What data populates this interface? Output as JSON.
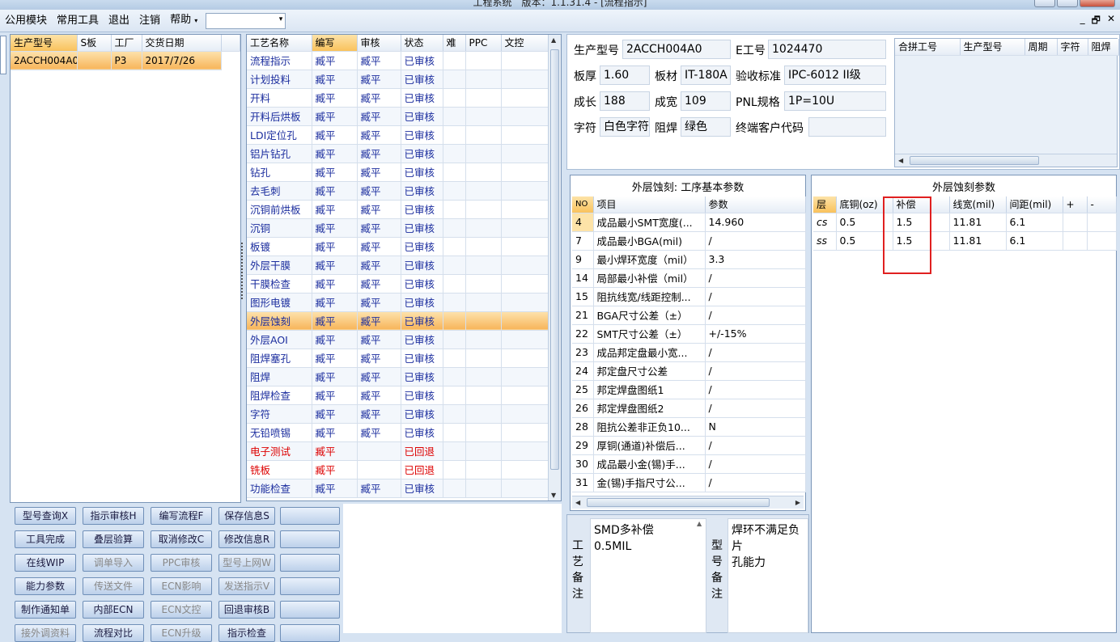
{
  "window": {
    "title": "工程系统　版本：1.1.31.4 - [流程指示]"
  },
  "menu": {
    "items": [
      "公用模块",
      "常用工具",
      "退出",
      "注销",
      "帮助"
    ],
    "help_arrow": "▾"
  },
  "mdi": {
    "minimize": "_",
    "restore": "🗗",
    "close": "✕"
  },
  "orders": {
    "columns": [
      "生产型号",
      "S板",
      "工厂",
      "交货日期"
    ],
    "rows": [
      [
        "2ACCH004A0",
        "",
        "P3",
        "2017/7/26"
      ]
    ]
  },
  "process": {
    "columns": [
      "工艺名称",
      "编写",
      "审核",
      "状态",
      "难",
      "PPC",
      "文控"
    ],
    "rows": [
      {
        "name": "流程指示",
        "writer": "臧平",
        "reviewer": "臧平",
        "status": "已审核",
        "red": false
      },
      {
        "name": "计划投料",
        "writer": "臧平",
        "reviewer": "臧平",
        "status": "已审核",
        "red": false
      },
      {
        "name": "开料",
        "writer": "臧平",
        "reviewer": "臧平",
        "status": "已审核",
        "red": false
      },
      {
        "name": "开料后烘板",
        "writer": "臧平",
        "reviewer": "臧平",
        "status": "已审核",
        "red": false
      },
      {
        "name": "LDI定位孔",
        "writer": "臧平",
        "reviewer": "臧平",
        "status": "已审核",
        "red": false
      },
      {
        "name": "铝片钻孔",
        "writer": "臧平",
        "reviewer": "臧平",
        "status": "已审核",
        "red": false
      },
      {
        "name": "钻孔",
        "writer": "臧平",
        "reviewer": "臧平",
        "status": "已审核",
        "red": false
      },
      {
        "name": "去毛刺",
        "writer": "臧平",
        "reviewer": "臧平",
        "status": "已审核",
        "red": false
      },
      {
        "name": "沉铜前烘板",
        "writer": "臧平",
        "reviewer": "臧平",
        "status": "已审核",
        "red": false
      },
      {
        "name": "沉铜",
        "writer": "臧平",
        "reviewer": "臧平",
        "status": "已审核",
        "red": false
      },
      {
        "name": "板镀",
        "writer": "臧平",
        "reviewer": "臧平",
        "status": "已审核",
        "red": false
      },
      {
        "name": "外层干膜",
        "writer": "臧平",
        "reviewer": "臧平",
        "status": "已审核",
        "red": false
      },
      {
        "name": "干膜检查",
        "writer": "臧平",
        "reviewer": "臧平",
        "status": "已审核",
        "red": false
      },
      {
        "name": "图形电镀",
        "writer": "臧平",
        "reviewer": "臧平",
        "status": "已审核",
        "red": false
      },
      {
        "name": "外层蚀刻",
        "writer": "臧平",
        "reviewer": "臧平",
        "status": "已审核",
        "red": false,
        "selected": true
      },
      {
        "name": "外层AOI",
        "writer": "臧平",
        "reviewer": "臧平",
        "status": "已审核",
        "red": false
      },
      {
        "name": "阻焊塞孔",
        "writer": "臧平",
        "reviewer": "臧平",
        "status": "已审核",
        "red": false
      },
      {
        "name": "阻焊",
        "writer": "臧平",
        "reviewer": "臧平",
        "status": "已审核",
        "red": false
      },
      {
        "name": "阻焊检查",
        "writer": "臧平",
        "reviewer": "臧平",
        "status": "已审核",
        "red": false
      },
      {
        "name": "字符",
        "writer": "臧平",
        "reviewer": "臧平",
        "status": "已审核",
        "red": false
      },
      {
        "name": "无铅喷锡",
        "writer": "臧平",
        "reviewer": "臧平",
        "status": "已审核",
        "red": false
      },
      {
        "name": "电子测试",
        "writer": "臧平",
        "reviewer": "",
        "status": "已回退",
        "red": true
      },
      {
        "name": "铣板",
        "writer": "臧平",
        "reviewer": "",
        "status": "已回退",
        "red": true
      },
      {
        "name": "功能检查",
        "writer": "臧平",
        "reviewer": "臧平",
        "status": "已审核",
        "red": false
      }
    ]
  },
  "buttons": [
    {
      "label": "型号查询X",
      "disabled": false
    },
    {
      "label": "指示审核H",
      "disabled": false
    },
    {
      "label": "编写流程F",
      "disabled": false
    },
    {
      "label": "保存信息S",
      "disabled": false
    },
    {
      "label": "",
      "disabled": false
    },
    {
      "label": "工具完成",
      "disabled": false
    },
    {
      "label": "叠层验算",
      "disabled": false
    },
    {
      "label": "取消修改C",
      "disabled": false
    },
    {
      "label": "修改信息R",
      "disabled": false
    },
    {
      "label": "",
      "disabled": false
    },
    {
      "label": "在线WIP",
      "disabled": false
    },
    {
      "label": "调单导入",
      "disabled": true
    },
    {
      "label": "PPC审核",
      "disabled": true
    },
    {
      "label": "型号上网W",
      "disabled": true
    },
    {
      "label": "",
      "disabled": false
    },
    {
      "label": "能力参数",
      "disabled": false
    },
    {
      "label": "传送文件",
      "disabled": true
    },
    {
      "label": "ECN影响",
      "disabled": true
    },
    {
      "label": "发送指示V",
      "disabled": true
    },
    {
      "label": "",
      "disabled": false
    },
    {
      "label": "制作通知单",
      "disabled": false
    },
    {
      "label": "内部ECN",
      "disabled": false
    },
    {
      "label": "ECN文控",
      "disabled": true
    },
    {
      "label": "回退审核B",
      "disabled": false
    },
    {
      "label": "",
      "disabled": false
    },
    {
      "label": "接外调资料",
      "disabled": true
    },
    {
      "label": "流程对比",
      "disabled": false
    },
    {
      "label": "ECN升级",
      "disabled": true
    },
    {
      "label": "指示检查",
      "disabled": false
    },
    {
      "label": "",
      "disabled": false
    }
  ],
  "info": {
    "model_label": "生产型号",
    "model": "2ACCH004A0",
    "e_label": "E工号",
    "e": "1024470",
    "thick_label": "板厚",
    "thick": "1.60",
    "mat_label": "板材",
    "mat": "IT-180A",
    "std_label": "验收标准",
    "std": "IPC-6012 II级",
    "len_label": "成长",
    "len": "188",
    "wid_label": "成宽",
    "wid": "109",
    "pnl_label": "PNL规格",
    "pnl": "1P=10U",
    "char_label": "字符",
    "char": "白色字符",
    "mask_label": "阻焊",
    "mask": "绿色",
    "cust_label": "终端客户代码",
    "cust": ""
  },
  "merge": {
    "columns": [
      "合拼工号",
      "生产型号",
      "周期",
      "字符",
      "阻焊"
    ]
  },
  "etch_basic": {
    "title": "外层蚀刻: 工序基本参数",
    "columns": [
      "NO",
      "项目",
      "参数"
    ],
    "rows": [
      [
        "4",
        "成品最小SMT宽度(...",
        "14.960"
      ],
      [
        "7",
        "成品最小BGA(mil)",
        "/"
      ],
      [
        "9",
        "最小焊环宽度（mil）",
        "3.3"
      ],
      [
        "14",
        "局部最小补偿（mil）",
        "/"
      ],
      [
        "15",
        "阻抗线宽/线距控制...",
        "/"
      ],
      [
        "21",
        "BGA尺寸公差（±）",
        "/"
      ],
      [
        "22",
        "SMT尺寸公差（±）",
        "+/-15%"
      ],
      [
        "23",
        "成品邦定盘最小宽...",
        "/"
      ],
      [
        "24",
        "邦定盘尺寸公差",
        "/"
      ],
      [
        "25",
        "邦定焊盘图纸1",
        "/"
      ],
      [
        "26",
        "邦定焊盘图纸2",
        "/"
      ],
      [
        "28",
        "阻抗公差非正负10...",
        "N"
      ],
      [
        "29",
        "厚铜(通道)补偿后...",
        "/"
      ],
      [
        "30",
        "成品最小金(锡)手...",
        "/"
      ],
      [
        "31",
        "金(锡)手指尺寸公...",
        "/"
      ]
    ]
  },
  "etch_params": {
    "title": "外层蚀刻参数",
    "columns": [
      "层",
      "底铜(oz)",
      "补偿",
      "线宽(mil)",
      "间距(mil)",
      "+",
      "-"
    ],
    "rows": [
      [
        "cs",
        "0.5",
        "1.5",
        "11.81",
        "6.1",
        "",
        ""
      ],
      [
        "ss",
        "0.5",
        "1.5",
        "11.81",
        "6.1",
        "",
        ""
      ]
    ]
  },
  "notes": {
    "process_label": "工艺备注",
    "process_text": "SMD多补偿\n0.5MIL",
    "model_label": "型号备注",
    "model_text": "焊环不满足负片\n孔能力"
  },
  "colors": {
    "accent": "#f9c25c",
    "highlight_box": "#e02020",
    "link_blue": "#1b2d9e",
    "error_red": "#dd0000"
  }
}
